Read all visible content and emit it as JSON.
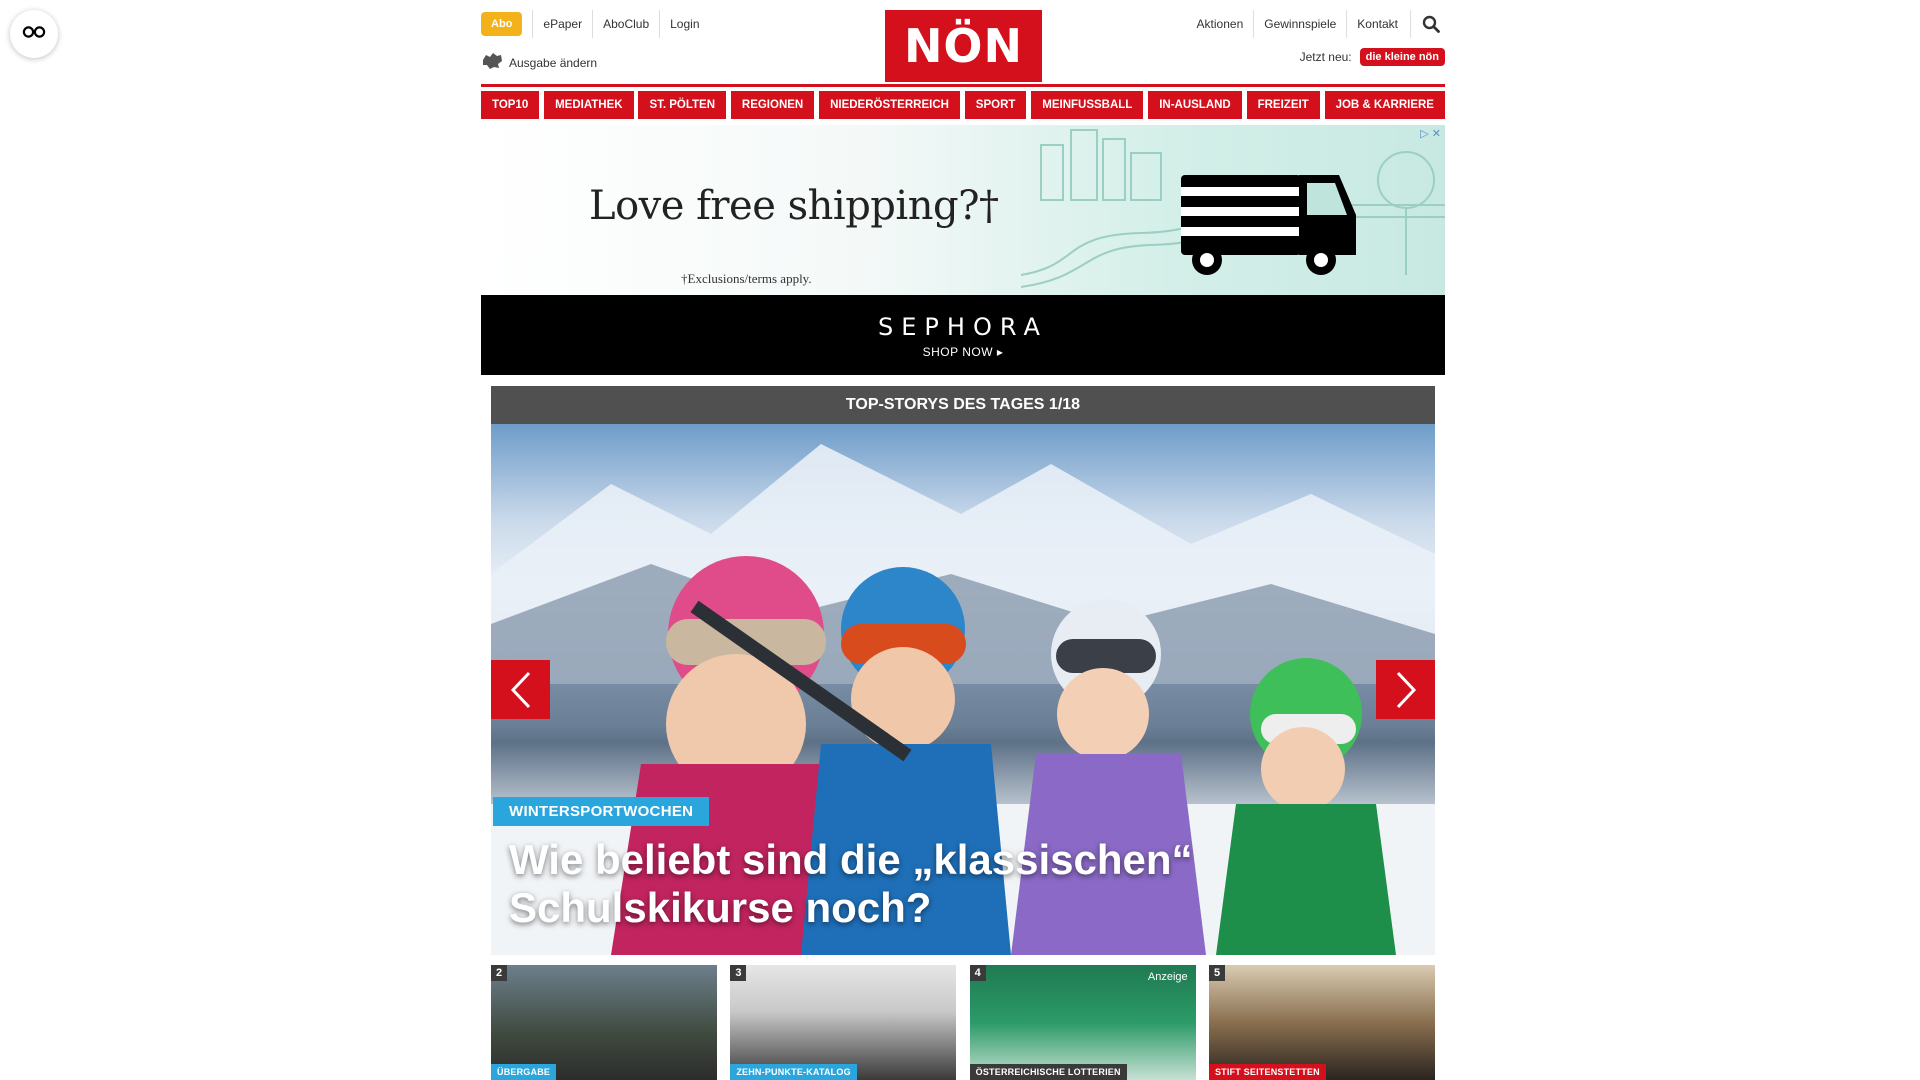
{
  "header": {
    "abo": "Abo",
    "left_links": [
      "ePaper",
      "AboClub",
      "Login"
    ],
    "ausgabe": "Ausgabe ändern",
    "logo": "NÖN",
    "right_links": [
      "Aktionen",
      "Gewinnspiele",
      "Kontakt"
    ],
    "jetzt_neu": "Jetzt neu:",
    "kleine_badge": "die kleine nön"
  },
  "nav": {
    "items": [
      "TOP10",
      "MEDIATHEK",
      "ST. PÖLTEN",
      "REGIONEN",
      "NIEDERÖSTERREICH",
      "SPORT",
      "MEINFUSSBALL",
      "IN-AUSLAND",
      "FREIZEIT",
      "JOB & KARRIERE"
    ]
  },
  "ad": {
    "headline": "Love free shipping?†",
    "terms": "†Exclusions/terms apply.",
    "brand": "SEPHORA",
    "cta": "SHOP NOW ▸",
    "close": "▷ ✕"
  },
  "carousel": {
    "heading": "TOP-STORYS DES TAGES 1/18",
    "tag": "WINTERSPORTWOCHEN",
    "title": "Wie beliebt sind die „klassischen“ Schulskikurse noch?"
  },
  "thumbs": [
    {
      "num": "2",
      "tag": "ÜBERGABE",
      "tag_color": "#2aa6dd"
    },
    {
      "num": "3",
      "tag": "ZEHN-PUNKTE-KATALOG",
      "tag_color": "#2aa6dd"
    },
    {
      "num": "4",
      "tag": "ÖSTERREICHISCHE LOTTERIEN",
      "tag_color": "#3a3a3a",
      "anzeige": "Anzeige"
    },
    {
      "num": "5",
      "tag": "STIFT SEITENSTETTEN",
      "tag_color": "#d3101c"
    }
  ],
  "colors": {
    "brand_red": "#d3101c",
    "abo_yellow": "#f3b21a",
    "tag_blue": "#2aa6dd"
  }
}
